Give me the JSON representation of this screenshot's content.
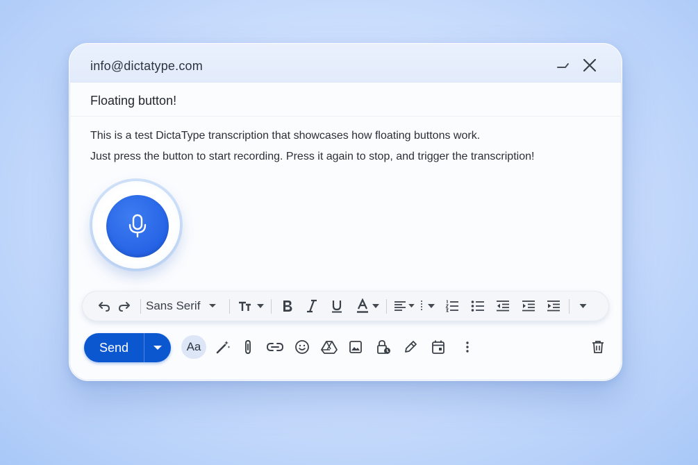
{
  "window": {
    "from_address": "info@dictatype.com",
    "subject": "Floating button!",
    "body_lines": [
      "This is a test DictaType transcription that showcases how floating buttons work.",
      "Just press the button to start recording. Press it again to stop, and trigger the transcription!"
    ]
  },
  "format_bar": {
    "font_family_label": "Sans Serif",
    "icons": [
      "undo-icon",
      "redo-icon",
      "font-size-icon",
      "bold-icon",
      "italic-icon",
      "underline-icon",
      "text-color-icon",
      "align-icon",
      "numbered-list-icon",
      "bulleted-list-icon",
      "indent-less-icon",
      "indent-more-icon",
      "quote-icon",
      "more-formatting-icon"
    ]
  },
  "bottom_toolbar": {
    "send_label": "Send",
    "format_toggle_label": "Aa",
    "icons": [
      "ai-write-icon",
      "attach-icon",
      "link-icon",
      "emoji-icon",
      "drive-icon",
      "photo-icon",
      "confidential-icon",
      "signature-icon",
      "schedule-icon",
      "more-options-icon",
      "delete-icon"
    ]
  },
  "colors": {
    "accent": "#0b57d0",
    "mic_button": "#2563e6",
    "titlebar": "#e6eefc",
    "background": "#cfe0fd"
  }
}
